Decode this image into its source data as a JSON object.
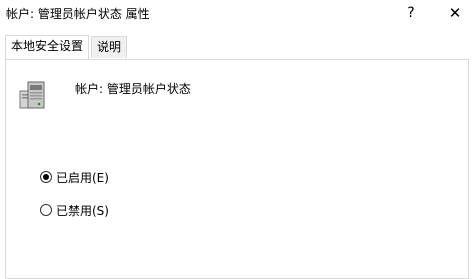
{
  "window": {
    "title": "帐户: 管理员帐户状态 属性",
    "help_label": "?",
    "close_label": "✕"
  },
  "tabs": [
    {
      "label": "本地安全设置",
      "active": true
    },
    {
      "label": "说明",
      "active": false
    }
  ],
  "policy": {
    "icon": "server-icon",
    "name": "帐户: 管理员帐户状态"
  },
  "options": [
    {
      "label": "已启用(E)",
      "checked": true
    },
    {
      "label": "已禁用(S)",
      "checked": false
    }
  ]
}
